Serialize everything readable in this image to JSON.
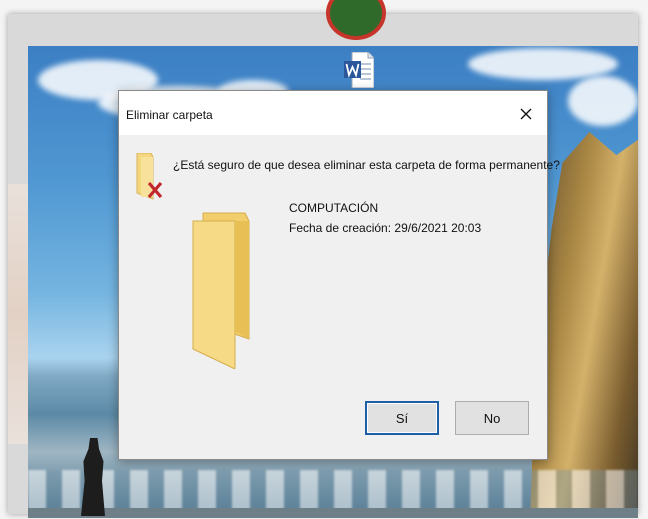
{
  "dialog": {
    "title": "Eliminar carpeta",
    "question": "¿Está seguro de que desea eliminar esta carpeta de forma permanente?",
    "item_name": "COMPUTACIÓN",
    "item_date": "Fecha de creación: 29/6/2021 20:03",
    "yes_label": "Sí",
    "no_label": "No"
  },
  "icons": {
    "close": "close-icon",
    "question": "folder-delete-icon",
    "folder": "folder-icon",
    "desktop": "word-document-icon"
  },
  "colors": {
    "default_button_border": "#1f5fa8",
    "delete_mark": "#c0282d",
    "folder": "#f4d67f",
    "word_blue": "#2b579a"
  }
}
